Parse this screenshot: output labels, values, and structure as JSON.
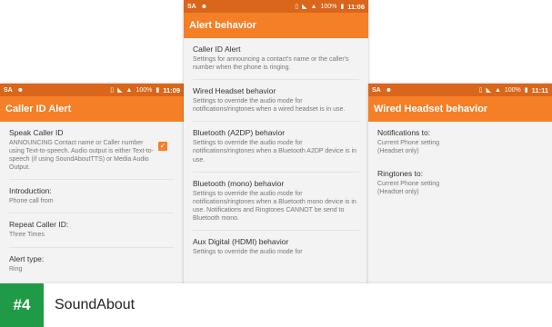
{
  "status_bar": {
    "carrier": "SA",
    "icons": [
      "person-icon",
      "vibrate-icon",
      "wifi-icon",
      "signal-icon",
      "battery-icon"
    ],
    "battery": "100%"
  },
  "left": {
    "time": "11:09",
    "title": "Caller ID Alert",
    "items": [
      {
        "title": "Speak Caller ID",
        "subtitle": "ANNOUNCING Contact name or Caller number using Text-to-speech. Audio output is either Text-to-speech (if using SoundAboutTTS) or Media Audio Output.",
        "checked": true
      },
      {
        "title": "Introduction:",
        "subtitle": "Phone call from"
      },
      {
        "title": "Repeat Caller ID:",
        "subtitle": "Three Times"
      },
      {
        "title": "Alert type:",
        "subtitle": "Ring"
      }
    ]
  },
  "center": {
    "time": "11:06",
    "title": "Alert behavior",
    "items": [
      {
        "title": "Caller ID Alert",
        "subtitle": "Settings for announcing a contact's name or the caller's number when the phone is ringing."
      },
      {
        "title": "Wired Headset behavior",
        "subtitle": "Settings to override the audio mode for notifications/ringtones when a wired headset is in use."
      },
      {
        "title": "Bluetooth (A2DP) behavior",
        "subtitle": "Settings to override the audio mode for notifications/ringtones when a Bluetooth A2DP device is in use."
      },
      {
        "title": "Bluetooth (mono) behavior",
        "subtitle": "Settings to override the audio mode for notifications/ringtones when a Bluetooth mono device is in use. Notifications and Ringtones CANNOT be send to Bluetooth mono."
      },
      {
        "title": "Aux Digital (HDMI) behavior",
        "subtitle": "Settings to override the audio mode for"
      }
    ]
  },
  "right": {
    "time": "11:11",
    "title": "Wired Headset behavior",
    "items": [
      {
        "title": "Notifications to:",
        "subtitle": "Current Phone setting\n(Headset only)"
      },
      {
        "title": "Ringtones to:",
        "subtitle": "Current Phone setting\n(Headset only)"
      }
    ]
  },
  "footer": {
    "rank": "#4",
    "app_name": "SoundAbout",
    "rank_color": "#1f9b47",
    "accent": "#f57f26"
  }
}
